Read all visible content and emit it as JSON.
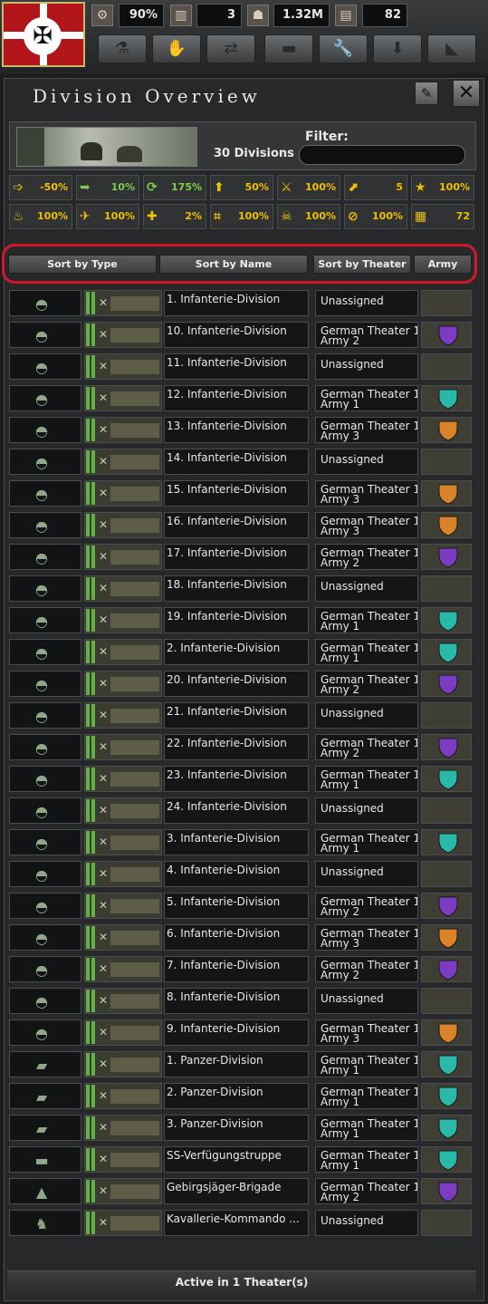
{
  "resources": {
    "stability": "90%",
    "factories": "3",
    "manpower": "1.32M",
    "civilian": "82"
  },
  "topbar_buttons": [
    "research-button",
    "diplomacy-button",
    "trade-button",
    "production-button",
    "construction-button",
    "recruit-button",
    "logistics-button"
  ],
  "window": {
    "title": "Division Overview",
    "division_count": "30 Divisions",
    "filter_label": "Filter:",
    "filter_value": ""
  },
  "modifiers_row1": [
    {
      "icon": "organization-icon",
      "value": "-50%",
      "color": "#f0c000"
    },
    {
      "icon": "speed-icon",
      "value": "10%",
      "color": "#7ed04a"
    },
    {
      "icon": "reinforce-icon",
      "value": "175%",
      "color": "#7ed04a"
    },
    {
      "icon": "supply-icon",
      "value": "50%",
      "color": "#f0c000"
    },
    {
      "icon": "attack-icon",
      "value": "100%",
      "color": "#f0c000"
    },
    {
      "icon": "entrenchment-icon",
      "value": "5",
      "color": "#f0c000"
    },
    {
      "icon": "experience-icon",
      "value": "100%",
      "color": "#f0c000"
    }
  ],
  "modifiers_row2": [
    {
      "icon": "fire-icon",
      "value": "100%",
      "color": "#f0c000"
    },
    {
      "icon": "air-icon",
      "value": "100%",
      "color": "#f0c000"
    },
    {
      "icon": "medical-icon",
      "value": "2%",
      "color": "#f0c000"
    },
    {
      "icon": "recovery-icon",
      "value": "100%",
      "color": "#f0c000"
    },
    {
      "icon": "skull-icon",
      "value": "100%",
      "color": "#f0c000"
    },
    {
      "icon": "no-entry-icon",
      "value": "100%",
      "color": "#f0c000"
    },
    {
      "icon": "equipment-icon",
      "value": "72",
      "color": "#f0c000"
    }
  ],
  "sort": {
    "by_type": "Sort by Type",
    "by_name": "Sort by Name",
    "by_theater": "Sort by Theater",
    "army": "Army"
  },
  "divisions": [
    {
      "type": "infantry",
      "name": "1. Infanterie-Division",
      "theater1": "Unassigned",
      "theater2": "",
      "army": ""
    },
    {
      "type": "infantry",
      "name": "10. Infanterie-Division",
      "theater1": "German Theater 1",
      "theater2": "Army 2",
      "army": "purple"
    },
    {
      "type": "infantry",
      "name": "11. Infanterie-Division",
      "theater1": "Unassigned",
      "theater2": "",
      "army": ""
    },
    {
      "type": "infantry",
      "name": "12. Infanterie-Division",
      "theater1": "German Theater 1",
      "theater2": "Army 1",
      "army": "teal"
    },
    {
      "type": "infantry",
      "name": "13. Infanterie-Division",
      "theater1": "German Theater 1",
      "theater2": "Army 3",
      "army": "orange"
    },
    {
      "type": "infantry",
      "name": "14. Infanterie-Division",
      "theater1": "Unassigned",
      "theater2": "",
      "army": ""
    },
    {
      "type": "infantry",
      "name": "15. Infanterie-Division",
      "theater1": "German Theater 1",
      "theater2": "Army 3",
      "army": "orange"
    },
    {
      "type": "infantry",
      "name": "16. Infanterie-Division",
      "theater1": "German Theater 1",
      "theater2": "Army 3",
      "army": "orange"
    },
    {
      "type": "infantry",
      "name": "17. Infanterie-Division",
      "theater1": "German Theater 1",
      "theater2": "Army 2",
      "army": "purple"
    },
    {
      "type": "infantry",
      "name": "18. Infanterie-Division",
      "theater1": "Unassigned",
      "theater2": "",
      "army": ""
    },
    {
      "type": "infantry",
      "name": "19. Infanterie-Division",
      "theater1": "German Theater 1",
      "theater2": "Army 1",
      "army": "teal"
    },
    {
      "type": "infantry",
      "name": "2. Infanterie-Division",
      "theater1": "German Theater 1",
      "theater2": "Army 1",
      "army": "teal"
    },
    {
      "type": "infantry",
      "name": "20. Infanterie-Division",
      "theater1": "German Theater 1",
      "theater2": "Army 2",
      "army": "purple"
    },
    {
      "type": "infantry",
      "name": "21. Infanterie-Division",
      "theater1": "Unassigned",
      "theater2": "",
      "army": ""
    },
    {
      "type": "infantry",
      "name": "22. Infanterie-Division",
      "theater1": "German Theater 1",
      "theater2": "Army 2",
      "army": "purple"
    },
    {
      "type": "infantry",
      "name": "23. Infanterie-Division",
      "theater1": "German Theater 1",
      "theater2": "Army 1",
      "army": "teal"
    },
    {
      "type": "infantry",
      "name": "24. Infanterie-Division",
      "theater1": "Unassigned",
      "theater2": "",
      "army": ""
    },
    {
      "type": "infantry",
      "name": "3. Infanterie-Division",
      "theater1": "German Theater 1",
      "theater2": "Army 1",
      "army": "teal"
    },
    {
      "type": "infantry",
      "name": "4. Infanterie-Division",
      "theater1": "Unassigned",
      "theater2": "",
      "army": ""
    },
    {
      "type": "infantry",
      "name": "5. Infanterie-Division",
      "theater1": "German Theater 1",
      "theater2": "Army 2",
      "army": "purple"
    },
    {
      "type": "infantry",
      "name": "6. Infanterie-Division",
      "theater1": "German Theater 1",
      "theater2": "Army 3",
      "army": "orange"
    },
    {
      "type": "infantry",
      "name": "7. Infanterie-Division",
      "theater1": "German Theater 1",
      "theater2": "Army 2",
      "army": "purple"
    },
    {
      "type": "infantry",
      "name": "8. Infanterie-Division",
      "theater1": "Unassigned",
      "theater2": "",
      "army": ""
    },
    {
      "type": "infantry",
      "name": "9. Infanterie-Division",
      "theater1": "German Theater 1",
      "theater2": "Army 3",
      "army": "orange"
    },
    {
      "type": "tank",
      "name": "1. Panzer-Division",
      "theater1": "German Theater 1",
      "theater2": "Army 1",
      "army": "teal"
    },
    {
      "type": "tank",
      "name": "2. Panzer-Division",
      "theater1": "German Theater 1",
      "theater2": "Army 1",
      "army": "teal"
    },
    {
      "type": "tank",
      "name": "3. Panzer-Division",
      "theater1": "German Theater 1",
      "theater2": "Army 1",
      "army": "teal"
    },
    {
      "type": "motorized",
      "name": "SS-Verfügungstruppe",
      "theater1": "German Theater 1",
      "theater2": "Army 1",
      "army": "teal"
    },
    {
      "type": "mountain",
      "name": "Gebirgsjäger-Brigade",
      "theater1": "German Theater 1",
      "theater2": "Army 2",
      "army": "purple"
    },
    {
      "type": "cavalry",
      "name": "Kavallerie-Kommando ...",
      "theater1": "Unassigned",
      "theater2": "",
      "army": ""
    }
  ],
  "type_icons": {
    "infantry": "helmet-icon",
    "tank": "tank-icon",
    "motorized": "truck-icon",
    "mountain": "mountain-icon",
    "cavalry": "horse-icon"
  },
  "army_colors": {
    "purple": "#7b3bc2",
    "teal": "#2ab8a8",
    "orange": "#d8822a"
  },
  "footer": "Active in 1 Theater(s)"
}
